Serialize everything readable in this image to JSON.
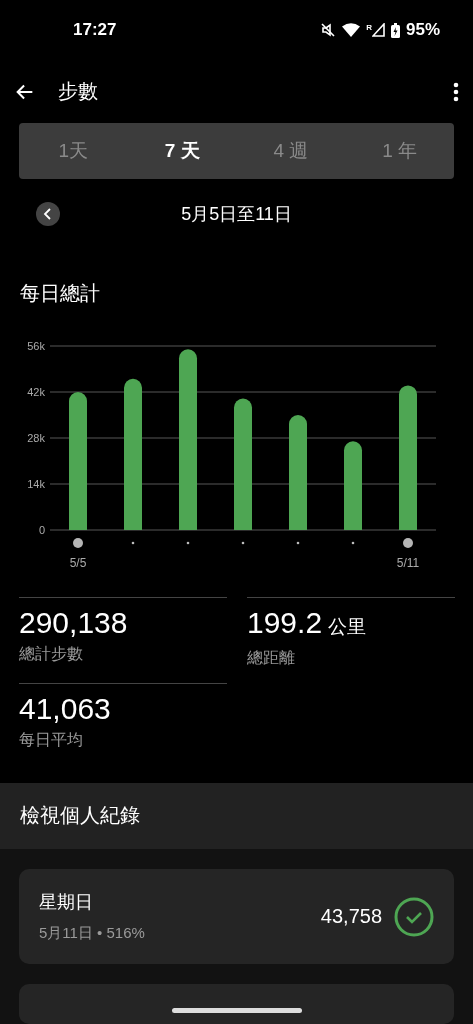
{
  "status_bar": {
    "time": "17:27",
    "signal_label": "R",
    "battery": "95%"
  },
  "app_bar": {
    "title": "步數"
  },
  "tabs": [
    {
      "label": "1天",
      "selected": false
    },
    {
      "label": "7 天",
      "selected": true
    },
    {
      "label": "4 週",
      "selected": false
    },
    {
      "label": "1 年",
      "selected": false
    }
  ],
  "date_range": "5月5日至11日",
  "daily_total": {
    "title": "每日總計",
    "chart_data": {
      "type": "bar",
      "categories": [
        "5/5",
        null,
        null,
        null,
        null,
        null,
        "5/11"
      ],
      "values": [
        42000,
        46000,
        55000,
        40000,
        35000,
        27000,
        44000
      ],
      "ylim": [
        0,
        56000
      ],
      "grid": true,
      "yticks": [
        {
          "value": 0,
          "label": "0"
        },
        {
          "value": 14000,
          "label": "14k"
        },
        {
          "value": 28000,
          "label": "28k"
        },
        {
          "value": 42000,
          "label": "42k"
        },
        {
          "value": 56000,
          "label": "56k"
        }
      ]
    }
  },
  "stats": [
    {
      "value": "290,138",
      "label": "總計步數"
    },
    {
      "value": "199.2",
      "unit": "公里",
      "label": "總距離"
    },
    {
      "value": "41,063",
      "label": "每日平均"
    }
  ],
  "records": {
    "title": "檢視個人紀錄",
    "items": [
      {
        "day": "星期日",
        "detail": "5月11日 • 516%",
        "steps": "43,758",
        "achieved": true
      }
    ]
  }
}
